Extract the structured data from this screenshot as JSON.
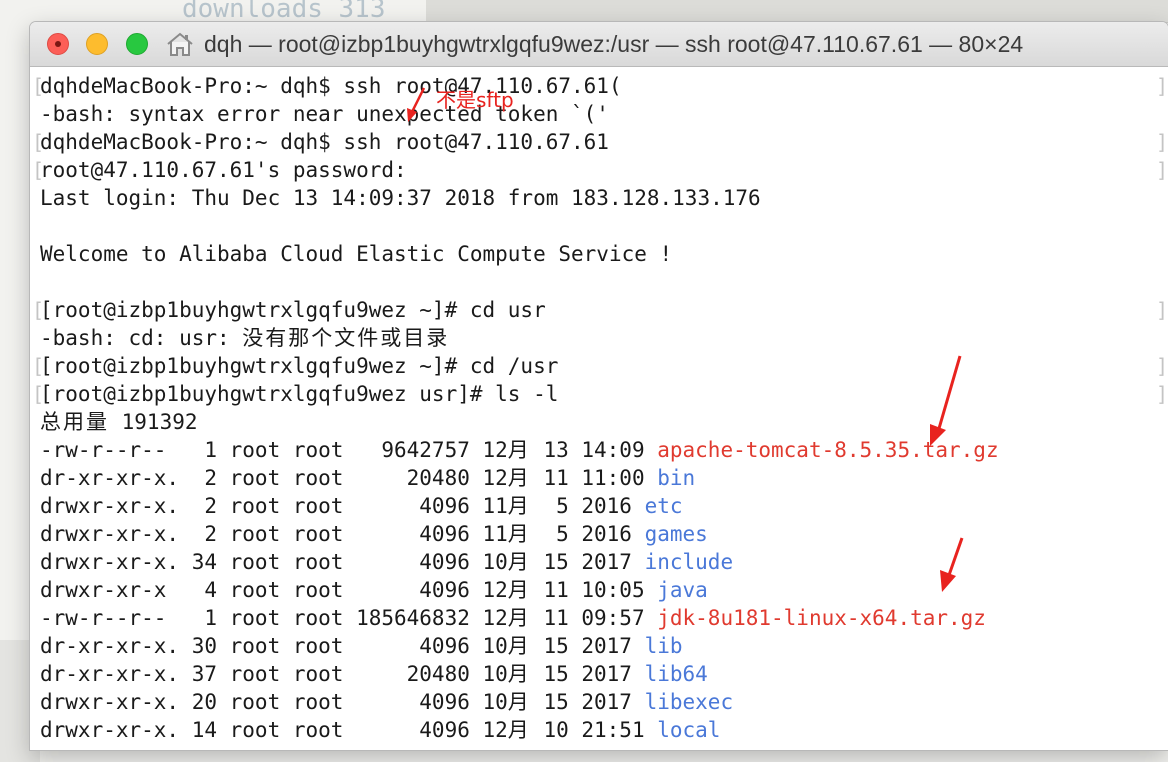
{
  "background": {
    "text": "downloads 313"
  },
  "window": {
    "title": "dqh — root@izbp1buyhgwtrxlgqfu9wez:/usr — ssh root@47.110.67.61 — 80×24",
    "icon": "home-icon",
    "traffic_lights": [
      "close",
      "minimize",
      "zoom"
    ]
  },
  "colors": {
    "red_file": "#e03a2f",
    "blue_dir": "#4a78d8",
    "annotation": "#e8231f"
  },
  "terminal": {
    "lines": [
      {
        "text": "dqhdeMacBook-Pro:~ dqh$ ssh root@47.110.67.61(",
        "bracketed": true
      },
      {
        "text": "-bash: syntax error near unexpected token `('",
        "bracketed": false
      },
      {
        "text": "dqhdeMacBook-Pro:~ dqh$ ssh root@47.110.67.61",
        "bracketed": true
      },
      {
        "text": "root@47.110.67.61's password:",
        "bracketed": true
      },
      {
        "text": "Last login: Thu Dec 13 14:09:37 2018 from 183.128.133.176",
        "bracketed": false
      },
      {
        "text": "",
        "bracketed": false
      },
      {
        "text": "Welcome to Alibaba Cloud Elastic Compute Service !",
        "bracketed": false
      },
      {
        "text": "",
        "bracketed": false
      },
      {
        "text": "[root@izbp1buyhgwtrxlgqfu9wez ~]# cd usr",
        "bracketed": true
      },
      {
        "text": "-bash: cd: usr: 没有那个文件或目录",
        "bracketed": false
      },
      {
        "text": "[root@izbp1buyhgwtrxlgqfu9wez ~]# cd /usr",
        "bracketed": true
      },
      {
        "text": "[root@izbp1buyhgwtrxlgqfu9wez usr]# ls -l",
        "bracketed": true
      },
      {
        "text": "总用量 191392",
        "bracketed": false
      }
    ],
    "listing": [
      {
        "perm": "-rw-r--r--   1 root root   9642757 12月 13 14:09 ",
        "name": "apache-tomcat-8.5.35.tar.gz",
        "color": "red"
      },
      {
        "perm": "dr-xr-xr-x.  2 root root     20480 12月 11 11:00 ",
        "name": "bin",
        "color": "blue"
      },
      {
        "perm": "drwxr-xr-x.  2 root root      4096 11月  5 2016 ",
        "name": "etc",
        "color": "blue"
      },
      {
        "perm": "drwxr-xr-x.  2 root root      4096 11月  5 2016 ",
        "name": "games",
        "color": "blue"
      },
      {
        "perm": "drwxr-xr-x. 34 root root      4096 10月 15 2017 ",
        "name": "include",
        "color": "blue"
      },
      {
        "perm": "drwxr-xr-x   4 root root      4096 12月 11 10:05 ",
        "name": "java",
        "color": "blue"
      },
      {
        "perm": "-rw-r--r--   1 root root 185646832 12月 11 09:57 ",
        "name": "jdk-8u181-linux-x64.tar.gz",
        "color": "red"
      },
      {
        "perm": "dr-xr-xr-x. 30 root root      4096 10月 15 2017 ",
        "name": "lib",
        "color": "blue"
      },
      {
        "perm": "dr-xr-xr-x. 37 root root     20480 10月 15 2017 ",
        "name": "lib64",
        "color": "blue"
      },
      {
        "perm": "drwxr-xr-x. 20 root root      4096 10月 15 2017 ",
        "name": "libexec",
        "color": "blue"
      },
      {
        "perm": "drwxr-xr-x. 14 root root      4096 12月 10 21:51 ",
        "name": "local",
        "color": "blue"
      }
    ]
  },
  "annotations": {
    "label": "不是sftp",
    "arrows": [
      "arrow-to-tomcat",
      "arrow-to-jdk",
      "arrow-to-parenthesis"
    ]
  }
}
